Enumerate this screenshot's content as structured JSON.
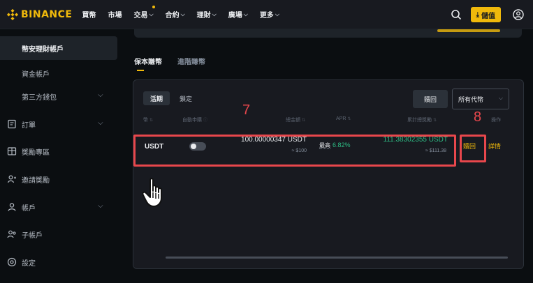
{
  "header": {
    "logo_text": "BINANCE",
    "nav": [
      {
        "label": "買幣",
        "has_chevron": false
      },
      {
        "label": "市場",
        "has_chevron": false
      },
      {
        "label": "交易",
        "has_chevron": true,
        "badge": true
      },
      {
        "label": "合約",
        "has_chevron": true
      },
      {
        "label": "理財",
        "has_chevron": true
      },
      {
        "label": "廣場",
        "has_chevron": true
      },
      {
        "label": "更多",
        "has_chevron": true
      }
    ],
    "deposit_label": "儲值",
    "icons": [
      "search-icon",
      "download-icon",
      "user-icon"
    ]
  },
  "sidebar": {
    "items": [
      {
        "label": "幣安理財帳戶",
        "active": true,
        "icon": "",
        "chevron": false
      },
      {
        "label": "資金帳戶",
        "active": false,
        "icon": "",
        "chevron": false
      },
      {
        "label": "第三方錢包",
        "active": false,
        "icon": "",
        "chevron": true
      },
      {
        "label": "訂單",
        "active": false,
        "icon": "orders-icon",
        "chevron": true
      },
      {
        "label": "獎勵專區",
        "active": false,
        "icon": "rewards-icon",
        "chevron": false
      },
      {
        "label": "邀請獎勵",
        "active": false,
        "icon": "referral-icon",
        "chevron": false
      },
      {
        "label": "帳戶",
        "active": false,
        "icon": "account-icon",
        "chevron": true
      },
      {
        "label": "子帳戶",
        "active": false,
        "icon": "subaccount-icon",
        "chevron": false
      },
      {
        "label": "設定",
        "active": false,
        "icon": "settings-icon",
        "chevron": false
      }
    ]
  },
  "main": {
    "tabs": [
      {
        "label": "保本賺幣",
        "active": true
      },
      {
        "label": "進階賺幣",
        "active": false
      }
    ],
    "subtabs": [
      {
        "label": "活期",
        "active": true
      },
      {
        "label": "鎖定",
        "active": false
      }
    ],
    "redeem_button": "贖回",
    "coin_filter": "所有代幣",
    "table": {
      "headers": {
        "coin": "幣",
        "auto_subscribe": "自動申購",
        "total_amount": "總金額",
        "apr": "APR",
        "cumulative_earnings": "累計總獎勵",
        "actions": "操作"
      },
      "rows": [
        {
          "coin": "USDT",
          "auto_subscribe_on": false,
          "amount": "100.00000347 USDT",
          "amount_usd": "≈ $100",
          "apr_label": "最高",
          "apr_value": "6.82%",
          "earnings": "111.38302355 USDT",
          "earnings_usd": "≈ $111.38",
          "action_redeem": "贖回",
          "action_detail": "詳情"
        }
      ]
    }
  },
  "annotations": [
    {
      "number": "7"
    },
    {
      "number": "8"
    }
  ],
  "colors": {
    "accent": "#f0b90b",
    "positive": "#2ebd85",
    "annotation": "#e8474c",
    "background": "#0b0e11",
    "panel": "#181a20"
  }
}
